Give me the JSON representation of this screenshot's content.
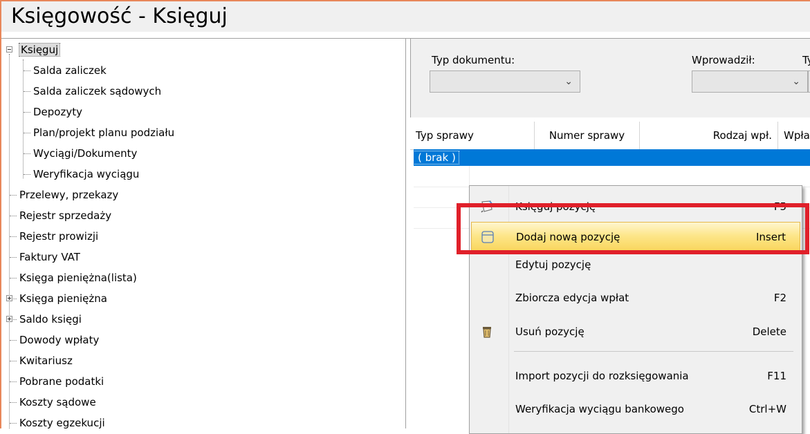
{
  "window": {
    "title": "Księgowość - Księguj"
  },
  "tree": {
    "root": {
      "label": "Księguj"
    },
    "children": [
      {
        "label": "Salda zaliczek"
      },
      {
        "label": "Salda zaliczek sądowych"
      },
      {
        "label": "Depozyty"
      },
      {
        "label": "Plan/projekt planu podziału"
      },
      {
        "label": "Wyciągi/Dokumenty"
      },
      {
        "label": "Weryfikacja wyciągu"
      }
    ],
    "items": [
      {
        "label": "Przelewy, przekazy"
      },
      {
        "label": "Rejestr sprzedaży"
      },
      {
        "label": "Rejestr prowizji"
      },
      {
        "label": "Faktury VAT"
      },
      {
        "label": "Księga pieniężna(lista)"
      },
      {
        "label": "Księga pieniężna"
      },
      {
        "label": "Saldo księgi"
      },
      {
        "label": "Dowody wpłaty"
      },
      {
        "label": "Kwitariusz"
      },
      {
        "label": "Pobrane podatki"
      },
      {
        "label": "Koszty sądowe"
      },
      {
        "label": "Koszty egzekucji"
      }
    ]
  },
  "filters": {
    "doc_type_label": "Typ dokumentu:",
    "entered_by_label": "Wprowadził:",
    "third_label": "Ty",
    "doc_type_value": "",
    "entered_by_value": ""
  },
  "grid": {
    "columns": [
      "Typ sprawy",
      "Numer sprawy",
      "Rodzaj wpł.",
      "Wpła"
    ],
    "selected_row_value": "( brak )"
  },
  "context_menu": {
    "items": [
      {
        "label": "Księguj pozycję",
        "shortcut": "F5",
        "icon": "post-entry-icon"
      },
      {
        "label": "Dodaj nową pozycję",
        "shortcut": "Insert",
        "icon": "add-entry-icon"
      },
      {
        "label": "Edytuj pozycję",
        "shortcut": ""
      },
      {
        "label": "Zbiorcza edycja wpłat",
        "shortcut": "F2"
      },
      {
        "label": "Usuń pozycję",
        "shortcut": "Delete",
        "icon": "delete-entry-icon"
      },
      {
        "label": "Import pozycji do rozksięgowania",
        "shortcut": "F11"
      },
      {
        "label": "Weryfikacja wyciągu bankowego",
        "shortcut": "Ctrl+W"
      }
    ]
  },
  "colors": {
    "selection": "#0078d7",
    "menu_highlight": "#fde68a",
    "annotation": "#e0202a",
    "window_border": "#e8875a"
  }
}
